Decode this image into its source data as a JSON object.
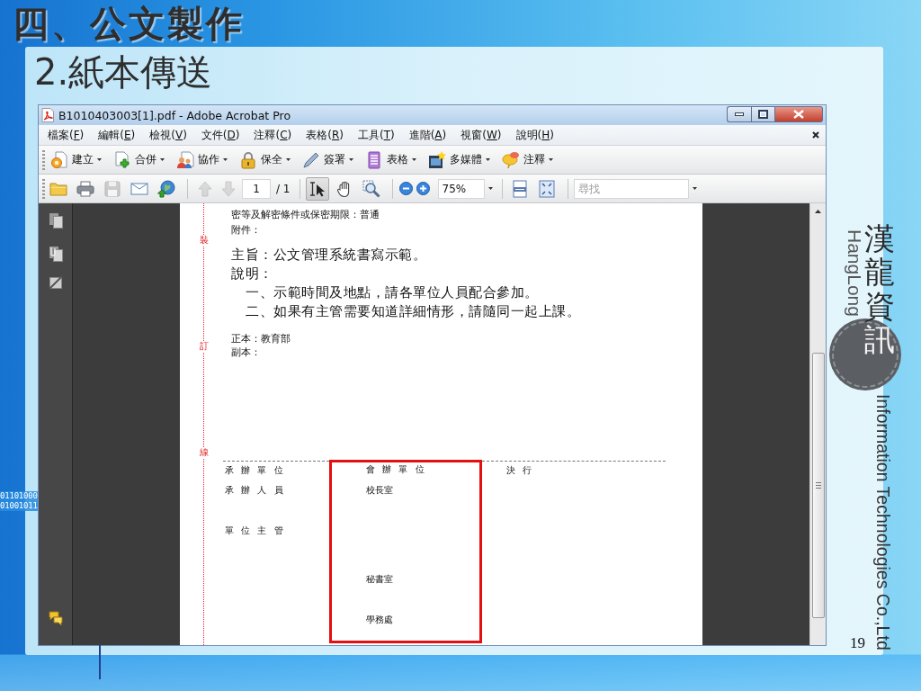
{
  "slide": {
    "title": "四、公文製作",
    "subtitle": "2.紙本傳送",
    "page_number": "19"
  },
  "background": {
    "binary_lines": [
      "01101000",
      "01001011"
    ]
  },
  "logo": {
    "name": "漢龍資訊",
    "romanized": "HangLong",
    "tagline": "Information Technologies Co.,Ltd"
  },
  "window": {
    "title": "B1010403003[1].pdf - Adobe Acrobat Pro"
  },
  "menu_bar": {
    "items": [
      "檔案(F)",
      "編輯(E)",
      "檢視(V)",
      "文件(D)",
      "注釋(C)",
      "表格(R)",
      "工具(T)",
      "進階(A)",
      "視窗(W)",
      "說明(H)"
    ]
  },
  "task_toolbar": {
    "buttons": [
      {
        "label": "建立"
      },
      {
        "label": "合併"
      },
      {
        "label": "協作"
      },
      {
        "label": "保全"
      },
      {
        "label": "簽署"
      },
      {
        "label": "表格"
      },
      {
        "label": "多媒體"
      },
      {
        "label": "注釋"
      }
    ]
  },
  "page_toolbar": {
    "file_buttons": [
      {
        "disabled": false
      },
      {
        "disabled": false
      },
      {
        "disabled": true
      },
      {
        "disabled": false
      },
      {
        "disabled": false
      }
    ],
    "nav_buttons": [
      {
        "disabled": true
      },
      {
        "disabled": true
      }
    ],
    "page_field": {
      "value": "1"
    },
    "page_total": "/ 1",
    "tools": [
      {
        "selected": true
      },
      {
        "selected": false
      },
      {
        "selected": false
      }
    ],
    "zoom_field": {
      "value": "75%"
    },
    "find_field": {
      "placeholder": "尋找"
    }
  },
  "document": {
    "binding_marks": [
      "裝",
      "訂",
      "線"
    ],
    "header_lines": [
      "密等及解密條件或保密期限：普通",
      "附件："
    ],
    "subject": "主旨：公文管理系統書寫示範。",
    "explanation_label": "說明：",
    "explanation_items": [
      "一、示範時間及地點，請各單位人員配合參加。",
      "二、如果有主管需要知道詳細情形，請隨同一起上課。"
    ],
    "recipient_lines": [
      "正本：教育部",
      "副本："
    ],
    "signoff": {
      "columns": [
        {
          "heading": "承 辦 單 位",
          "highlighted": false,
          "entries": [
            "承 辦 人 員",
            "單 位 主 管"
          ]
        },
        {
          "heading": "會 辦 單 位",
          "highlighted": true,
          "entries": [
            "校長室",
            "秘書室",
            "學務處"
          ]
        },
        {
          "heading": "決 行",
          "highlighted": false
        }
      ]
    }
  }
}
